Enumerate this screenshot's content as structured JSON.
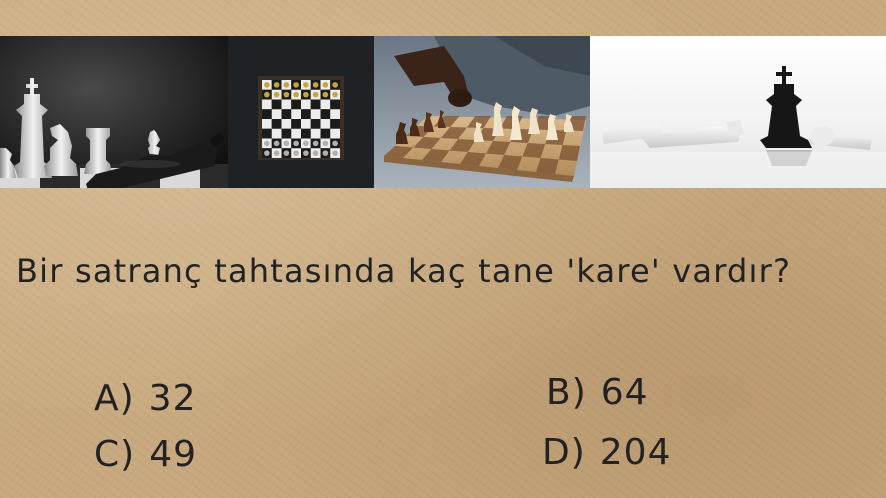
{
  "question": "Bir satranç tahtasında kaç tane 'kare' vardır?",
  "options": [
    {
      "letter": "A)",
      "value": "32"
    },
    {
      "letter": "B)",
      "value": "64"
    },
    {
      "letter": "C)",
      "value": "49"
    },
    {
      "letter": "D)",
      "value": "204"
    }
  ],
  "colors": {
    "background": "#c8a97f",
    "text": "#222222"
  }
}
